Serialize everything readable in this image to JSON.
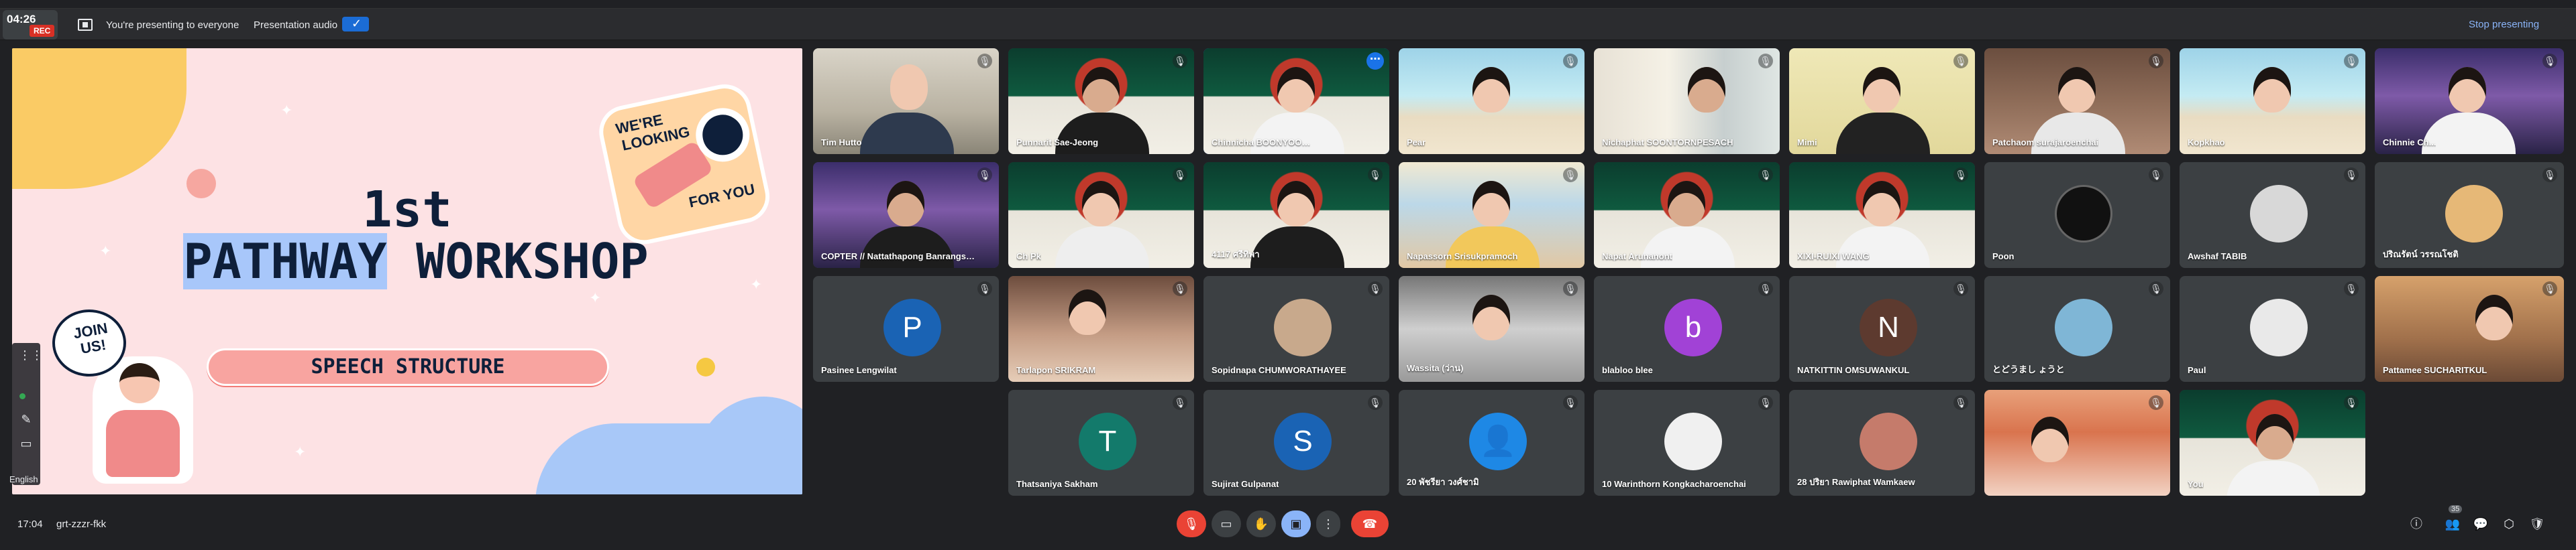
{
  "topbar": {
    "clock": "04:26",
    "rec": "REC",
    "presenting_text": "You're presenting to everyone",
    "audio_label": "Presentation audio",
    "stop_presenting": "Stop presenting"
  },
  "slide": {
    "title_line1": "1st",
    "title_word_highlight": "PATHWAY",
    "title_word_rest": "WORKSHOP",
    "pill": "SPEECH STRUCTURE",
    "sticker_looking": [
      "WE'RE",
      "LOOKING",
      "FOR YOU"
    ],
    "sticker_join": "JOIN US!",
    "language": "English"
  },
  "tiles": [
    {
      "name": "Tim Hutto",
      "mic_off": true
    },
    {
      "name": "Punnarit Sae-Jeong",
      "mic_off": true
    },
    {
      "name": "Chinnicha BOONYOO…",
      "mic_off": false
    },
    {
      "name": "Pear",
      "mic_off": true
    },
    {
      "name": "Nichaphat SOONTORNPESACH",
      "mic_off": true
    },
    {
      "name": "Mimi",
      "mic_off": true
    },
    {
      "name": "Patchaom surajaroenchai",
      "mic_off": true
    },
    {
      "name": "Kopkhao",
      "mic_off": true
    },
    {
      "name": "Chinnie Ch...",
      "mic_off": true
    },
    {
      "name": "COPTER // Nattathapong Banrangsasiri…",
      "mic_off": true
    },
    {
      "name": "Ch Pk",
      "mic_off": true
    },
    {
      "name": "4117 ศรีทิพา",
      "mic_off": true
    },
    {
      "name": "Napassorn Srisukpramoch",
      "mic_off": true
    },
    {
      "name": "Napat Arunanont",
      "mic_off": true
    },
    {
      "name": "XIXI-RUIXI WANG",
      "mic_off": true
    },
    {
      "name": "Poon",
      "mic_off": true
    },
    {
      "name": "Awshaf TABIB",
      "mic_off": true
    },
    {
      "name": "ปริณรัตน์ วรรณโชติ",
      "mic_off": true
    },
    {
      "name": "Pasinee Lengwilat",
      "mic_off": true,
      "initial": "P",
      "color": "#1a63b4"
    },
    {
      "name": "Tarlapon SRIKRAM",
      "mic_off": true
    },
    {
      "name": "Sopidnapa CHUMWORATHAYEE",
      "mic_off": true
    },
    {
      "name": "Wassita (ว่าน)",
      "mic_off": true
    },
    {
      "name": "blabloo blee",
      "mic_off": true,
      "initial": "b",
      "color": "#a142d6"
    },
    {
      "name": "NATKITTIN OMSUWANKUL",
      "mic_off": true,
      "initial": "N",
      "color": "#5d3a2f"
    },
    {
      "name": "とどうまし ょうと",
      "mic_off": true
    },
    {
      "name": "Paul",
      "mic_off": true
    },
    {
      "name": "Pattamee SUCHARITKUL",
      "mic_off": true
    },
    {
      "name": "Thatsaniya Sakham",
      "mic_off": true,
      "initial": "T",
      "color": "#137a6b"
    },
    {
      "name": "Sujirat Gulpanat",
      "mic_off": true,
      "initial": "S",
      "color": "#1a63b4"
    },
    {
      "name": "20 พัชรียา วงศ์ชามิ",
      "mic_off": true
    },
    {
      "name": "10 Warinthorn Kongkacharoenchai",
      "mic_off": true
    },
    {
      "name": "28 ปริยา Rawiphat Wamkaew",
      "mic_off": true
    },
    {
      "name": "",
      "mic_off": true
    },
    {
      "name": "You",
      "mic_off": true
    }
  ],
  "bottombar": {
    "time": "17:04",
    "meeting_code": "grt-zzzr-fkk",
    "participant_count": "35"
  }
}
